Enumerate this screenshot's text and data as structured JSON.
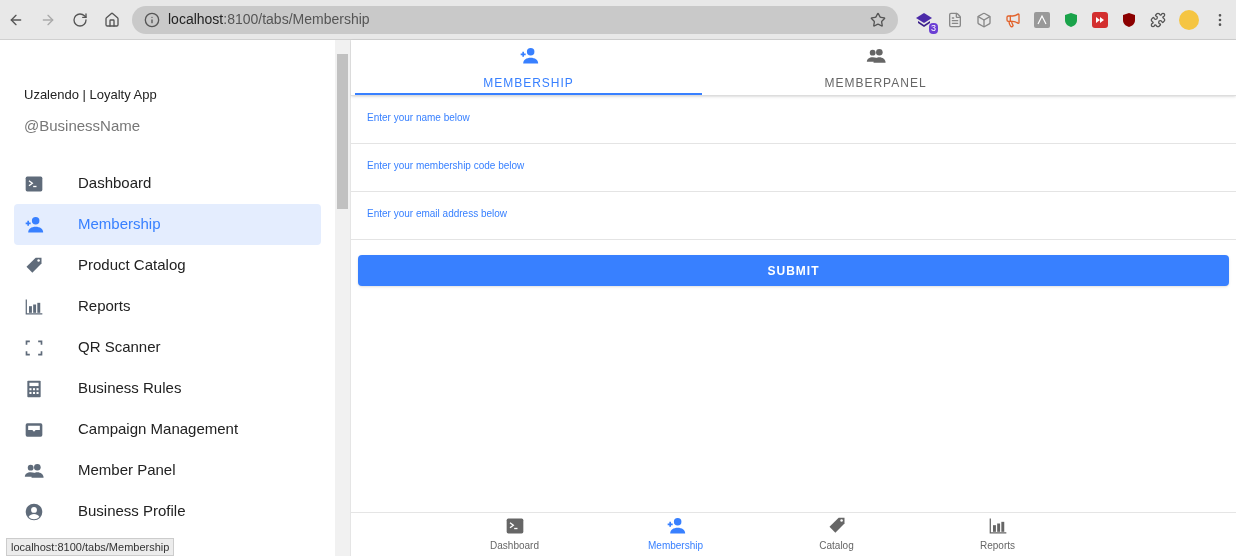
{
  "browser": {
    "url_host": "localhost",
    "url_rest": ":8100/tabs/Membership",
    "extension_badge": "3",
    "status_url": "localhost:8100/tabs/Membership"
  },
  "sidebar": {
    "app_title": "Uzalendo | Loyalty App",
    "business_name": "@BusinessName",
    "items": [
      {
        "label": "Dashboard",
        "kind": "terminal",
        "selected": false
      },
      {
        "label": "Membership",
        "kind": "person-add",
        "selected": true
      },
      {
        "label": "Product Catalog",
        "kind": "tag",
        "selected": false
      },
      {
        "label": "Reports",
        "kind": "chart",
        "selected": false
      },
      {
        "label": "QR Scanner",
        "kind": "scan",
        "selected": false
      },
      {
        "label": "Business Rules",
        "kind": "calculator",
        "selected": false
      },
      {
        "label": "Campaign Management",
        "kind": "inbox",
        "selected": false
      },
      {
        "label": "Member Panel",
        "kind": "people",
        "selected": false
      },
      {
        "label": "Business Profile",
        "kind": "person-circle",
        "selected": false
      }
    ]
  },
  "top_tabs": [
    {
      "label": "MEMBERSHIP",
      "kind": "person-add",
      "selected": true
    },
    {
      "label": "MEMBERPANEL",
      "kind": "people",
      "selected": false
    }
  ],
  "form": {
    "fields": [
      {
        "label": "Enter your name below"
      },
      {
        "label": "Enter your membership code below"
      },
      {
        "label": "Enter your email address below"
      }
    ],
    "submit": "SUBMIT"
  },
  "bottom_tabs": [
    {
      "label": "Dashboard",
      "kind": "terminal",
      "selected": false
    },
    {
      "label": "Membership",
      "kind": "person-add",
      "selected": true
    },
    {
      "label": "Catalog",
      "kind": "tag",
      "selected": false
    },
    {
      "label": "Reports",
      "kind": "chart",
      "selected": false
    }
  ]
}
